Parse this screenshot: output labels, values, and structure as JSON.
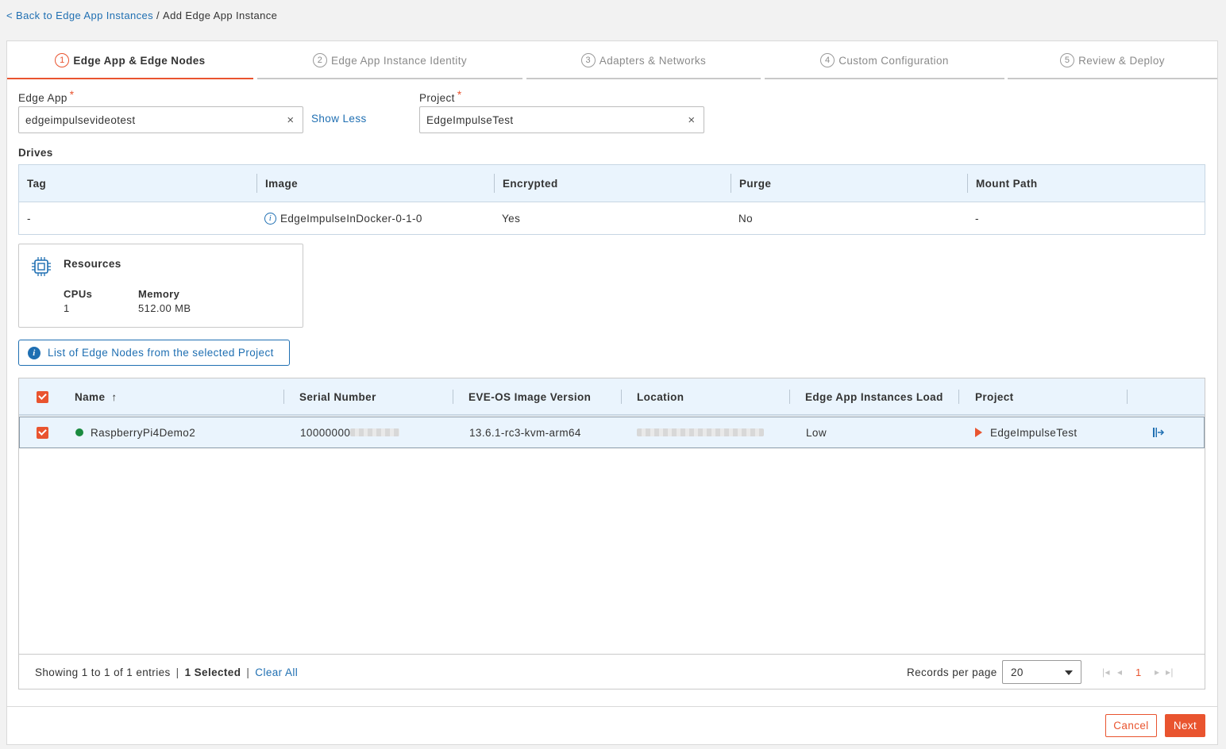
{
  "breadcrumb": {
    "back_label": "< Back to Edge App Instances",
    "separator": "/",
    "current": "Add Edge App Instance"
  },
  "tabs": [
    {
      "num": "1",
      "label": "Edge App & Edge Nodes"
    },
    {
      "num": "2",
      "label": "Edge App Instance Identity"
    },
    {
      "num": "3",
      "label": "Adapters & Networks"
    },
    {
      "num": "4",
      "label": "Custom Configuration"
    },
    {
      "num": "5",
      "label": "Review & Deploy"
    }
  ],
  "form": {
    "edge_app_label": "Edge App",
    "edge_app_value": "edgeimpulsevideotest",
    "show_less": "Show Less",
    "project_label": "Project",
    "project_value": "EdgeImpulseTest",
    "required_mark": "*",
    "clear_symbol": "×"
  },
  "drives": {
    "title": "Drives",
    "columns": [
      "Tag",
      "Image",
      "Encrypted",
      "Purge",
      "Mount Path"
    ],
    "row": {
      "tag": "-",
      "image": "EdgeImpulseInDocker-0-1-0",
      "encrypted": "Yes",
      "purge": "No",
      "mount_path": "-"
    }
  },
  "resources": {
    "title": "Resources",
    "cpus_label": "CPUs",
    "cpus_value": "1",
    "memory_label": "Memory",
    "memory_value": "512.00 MB"
  },
  "nodes_banner": "List of Edge Nodes from the selected Project",
  "nodes": {
    "columns": [
      "Name",
      "Serial Number",
      "EVE-OS Image Version",
      "Location",
      "Edge App Instances Load",
      "Project"
    ],
    "sort_arrow": "↑",
    "rows": [
      {
        "name": "RaspberryPi4Demo2",
        "serial": "10000000",
        "eve_version": "13.6.1-rc3-kvm-arm64",
        "load": "Low",
        "project": "EdgeImpulseTest"
      }
    ]
  },
  "footer": {
    "showing": "Showing 1 to 1 of 1 entries",
    "pipe": "|",
    "selected": "1 Selected",
    "clear_all": "Clear All",
    "records_label": "Records per page",
    "records_value": "20",
    "current_page": "1"
  },
  "actions": {
    "cancel": "Cancel",
    "next": "Next"
  },
  "colors": {
    "accent": "#e9542f",
    "link": "#1f6fb2",
    "header_bg": "#eaf4fd",
    "status_online": "#1a8a3f"
  }
}
